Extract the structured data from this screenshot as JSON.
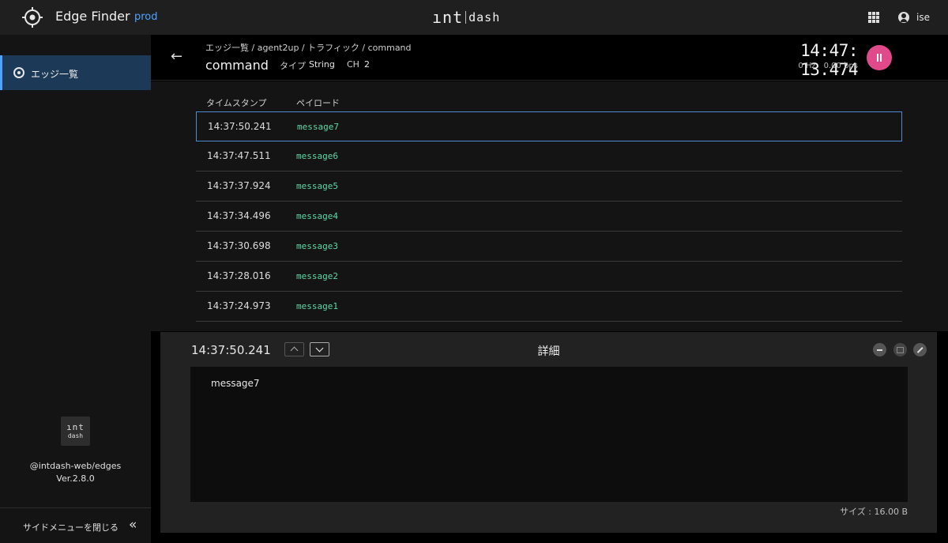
{
  "topbar": {
    "app_title": "Edge Finder",
    "environment": "prod",
    "logo_int": "ınt",
    "logo_dash": "dash",
    "user_name": "ise",
    "apps_icon": "grid-icon",
    "user_icon": "user-icon"
  },
  "sidebar": {
    "items": [
      {
        "label": "エッジ一覧",
        "icon": "target-icon",
        "active": true
      }
    ],
    "logo_int": "ınt",
    "logo_dash": "dash",
    "package": "@intdash-web/edges",
    "version": "Ver.2.8.0",
    "close_label": "サイドメニューを閉じる",
    "collapse_icon": "«"
  },
  "header": {
    "breadcrumb": "エッジ一覧 / agent2up / トラフィック / command",
    "title": "command",
    "type_label": "タイプ",
    "type_value": "String",
    "ch_label": "CH",
    "ch_value": "2",
    "clock": "14:47: 13.474",
    "frequency": "0 Hz",
    "bitrate": "0.00 bps",
    "back_icon": "←",
    "pause_icon": "pause-icon",
    "pause_color": "#e04a8a"
  },
  "table": {
    "columns": [
      "タイムスタンプ",
      "ペイロード"
    ],
    "rows": [
      {
        "timestamp": "14:37:50.241",
        "payload": "message7",
        "selected": true
      },
      {
        "timestamp": "14:37:47.511",
        "payload": "message6"
      },
      {
        "timestamp": "14:37:37.924",
        "payload": "message5"
      },
      {
        "timestamp": "14:37:34.496",
        "payload": "message4"
      },
      {
        "timestamp": "14:37:30.698",
        "payload": "message3"
      },
      {
        "timestamp": "14:37:28.016",
        "payload": "message2"
      },
      {
        "timestamp": "14:37:24.973",
        "payload": "message1"
      }
    ]
  },
  "detail": {
    "timestamp": "14:37:50.241",
    "title": "詳細",
    "payload": "message7",
    "size": "サイズ : 16.00 B"
  },
  "colors": {
    "accent": "#4fa3ff",
    "payload_text": "#5fd7a8",
    "selected_border": "#4d8ad0"
  }
}
